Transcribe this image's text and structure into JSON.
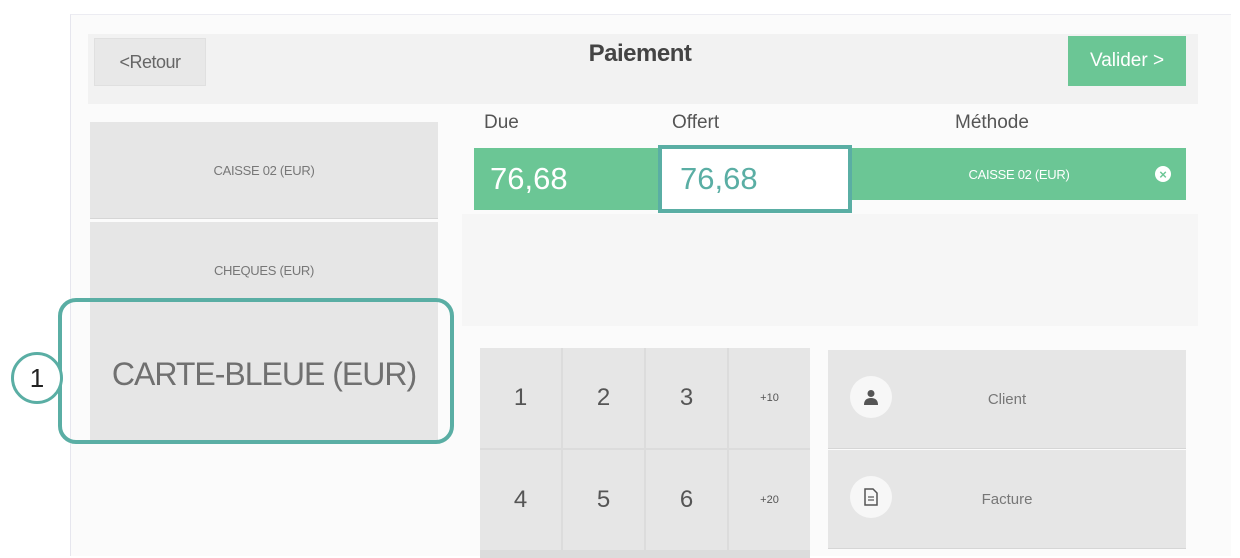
{
  "header": {
    "back_label": "<Retour",
    "title": "Paiement",
    "validate_label": "Valider >"
  },
  "methods": [
    {
      "label": "CAISSE 02 (EUR)"
    },
    {
      "label": "CHEQUES (EUR)"
    },
    {
      "label": "CARTE-BLEUE (EUR)"
    }
  ],
  "callout": {
    "number": "1"
  },
  "payment": {
    "due_label": "Due",
    "offered_label": "Offert",
    "method_label": "Méthode",
    "due_value": "76,68",
    "offered_value": "76,68",
    "method_value": "CAISSE 02 (EUR)",
    "remove_icon": "×"
  },
  "keypad": {
    "keys": [
      "1",
      "2",
      "3",
      "+10",
      "4",
      "5",
      "6",
      "+20"
    ]
  },
  "actions": {
    "client_label": "Client",
    "invoice_label": "Facture",
    "client_icon": "person-icon",
    "invoice_icon": "document-icon"
  },
  "colors": {
    "accent": "#6bc695",
    "highlight": "#5aaea4"
  }
}
